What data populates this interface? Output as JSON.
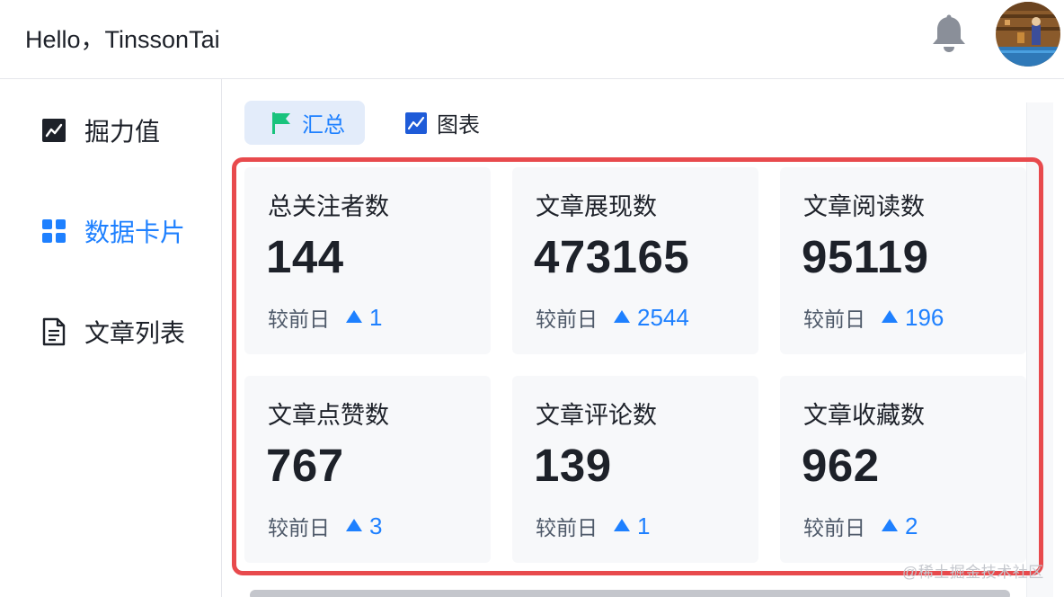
{
  "header": {
    "greeting": "Hello，TinssonTai",
    "bell_icon": "bell-icon",
    "avatar": "user-avatar"
  },
  "sidebar": {
    "items": [
      {
        "label": "掘力值",
        "icon": "trend-chart-icon",
        "active": false
      },
      {
        "label": "数据卡片",
        "icon": "grid-icon",
        "active": true
      },
      {
        "label": "文章列表",
        "icon": "document-icon",
        "active": false
      }
    ]
  },
  "tabs": [
    {
      "label": "汇总",
      "icon": "flag-icon",
      "active": true
    },
    {
      "label": "图表",
      "icon": "line-chart-icon",
      "active": false
    }
  ],
  "cards": [
    {
      "label": "总关注者数",
      "value": "144",
      "prev_label": "较前日",
      "delta": "1"
    },
    {
      "label": "文章展现数",
      "value": "473165",
      "prev_label": "较前日",
      "delta": "2544"
    },
    {
      "label": "文章阅读数",
      "value": "95119",
      "prev_label": "较前日",
      "delta": "196"
    },
    {
      "label": "文章点赞数",
      "value": "767",
      "prev_label": "较前日",
      "delta": "3"
    },
    {
      "label": "文章评论数",
      "value": "139",
      "prev_label": "较前日",
      "delta": "1"
    },
    {
      "label": "文章收藏数",
      "value": "962",
      "prev_label": "较前日",
      "delta": "2"
    }
  ],
  "colors": {
    "accent": "#1e80ff",
    "highlight_border": "#e84a4d",
    "card_bg": "#f7f8fa",
    "flag_green": "#19c37d"
  },
  "watermark": "@稀土掘金技术社区"
}
